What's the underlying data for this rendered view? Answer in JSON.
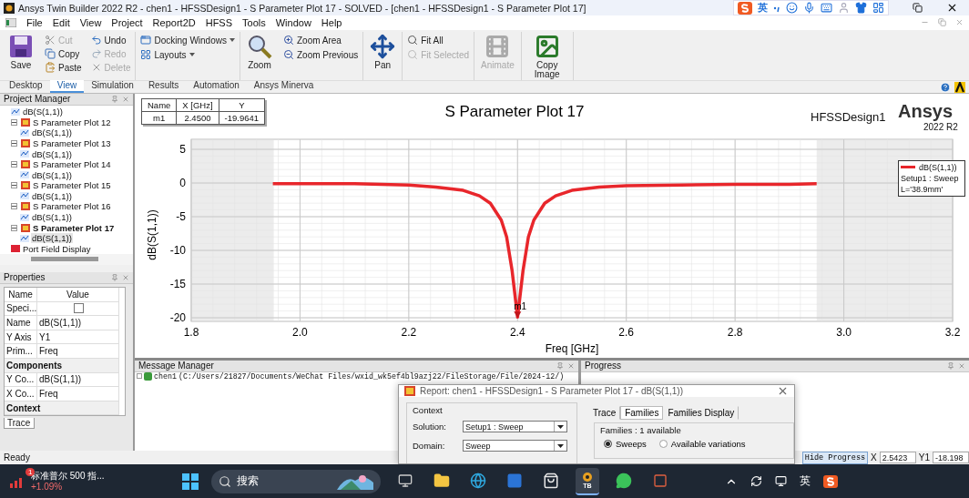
{
  "window": {
    "title": "Ansys Twin Builder 2022 R2 - chen1 - HFSSDesign1 - S Parameter Plot 17 - SOLVED - [chen1 - HFSSDesign1 - S Parameter Plot 17]"
  },
  "ime_toolbar": {
    "mode": "英"
  },
  "menu": [
    "File",
    "Edit",
    "View",
    "Project",
    "Report2D",
    "HFSS",
    "Tools",
    "Window",
    "Help"
  ],
  "ribbon": [
    {
      "kind": "large",
      "label": "Save",
      "disabled": false
    },
    {
      "kind": "stack",
      "items": [
        {
          "label": "Cut",
          "disabled": true
        },
        {
          "label": "Copy",
          "disabled": false
        },
        {
          "label": "Paste",
          "disabled": false
        }
      ]
    },
    {
      "kind": "stack",
      "items": [
        {
          "label": "Undo",
          "disabled": false
        },
        {
          "label": "Redo",
          "disabled": true
        },
        {
          "label": "Delete",
          "disabled": true
        }
      ],
      "divider": true
    },
    {
      "kind": "stack",
      "items": [
        {
          "label": "Docking Windows",
          "disabled": false,
          "dropdown": true
        },
        {
          "label": "Layouts",
          "disabled": false,
          "dropdown": true
        }
      ],
      "divider": true
    },
    {
      "kind": "large",
      "label": "Zoom",
      "disabled": false
    },
    {
      "kind": "stack",
      "items": [
        {
          "label": "Zoom Area",
          "disabled": false
        },
        {
          "label": "Zoom Previous",
          "disabled": false
        }
      ],
      "divider": true
    },
    {
      "kind": "large",
      "label": "Pan",
      "disabled": false,
      "divider": true
    },
    {
      "kind": "stack",
      "items": [
        {
          "label": "Fit All",
          "disabled": false
        },
        {
          "label": "Fit Selected",
          "disabled": true
        }
      ],
      "divider": true
    },
    {
      "kind": "large",
      "label": "Animate",
      "disabled": true,
      "divider": true
    },
    {
      "kind": "large",
      "label": "Copy Image",
      "disabled": false,
      "divider": true
    }
  ],
  "ribbon_tabs": [
    {
      "label": "Desktop",
      "selected": false
    },
    {
      "label": "View",
      "selected": true
    },
    {
      "label": "Simulation",
      "selected": false
    },
    {
      "label": "Results",
      "selected": false
    },
    {
      "label": "Automation",
      "selected": false
    },
    {
      "label": "Ansys Minerva",
      "selected": false
    }
  ],
  "project_manager": {
    "title": "Project Manager",
    "items": [
      {
        "kind": "trace",
        "label": "dB(S(1,1))",
        "selected": false
      },
      {
        "kind": "plot",
        "label": "S Parameter Plot 12",
        "selected": false,
        "expanded": true,
        "children": [
          {
            "kind": "trace",
            "label": "dB(S(1,1))",
            "selected": false
          }
        ]
      },
      {
        "kind": "plot",
        "label": "S Parameter Plot 13",
        "selected": false,
        "expanded": true,
        "children": [
          {
            "kind": "trace",
            "label": "dB(S(1,1))",
            "selected": false
          }
        ]
      },
      {
        "kind": "plot",
        "label": "S Parameter Plot 14",
        "selected": false,
        "expanded": true,
        "children": [
          {
            "kind": "trace",
            "label": "dB(S(1,1))",
            "selected": false
          }
        ]
      },
      {
        "kind": "plot",
        "label": "S Parameter Plot 15",
        "selected": false,
        "expanded": true,
        "children": [
          {
            "kind": "trace",
            "label": "dB(S(1,1))",
            "selected": false
          }
        ]
      },
      {
        "kind": "plot",
        "label": "S Parameter Plot 16",
        "selected": false,
        "expanded": true,
        "children": [
          {
            "kind": "trace",
            "label": "dB(S(1,1))",
            "selected": false
          }
        ]
      },
      {
        "kind": "plot",
        "label": "S Parameter Plot 17",
        "selected": true,
        "expanded": true,
        "children": [
          {
            "kind": "trace",
            "label": "dB(S(1,1))",
            "selected": true
          }
        ]
      },
      {
        "kind": "field",
        "label": "Port Field Display",
        "selected": false
      }
    ]
  },
  "properties": {
    "title": "Properties",
    "columns": [
      "Name",
      "Value"
    ],
    "rows": [
      {
        "kind": "checkbox",
        "name": "Speci...",
        "checked": false
      },
      {
        "kind": "row",
        "name": "Name",
        "value": "dB(S(1,1))"
      },
      {
        "kind": "row",
        "name": "Y Axis",
        "value": "Y1"
      },
      {
        "kind": "row",
        "name": "Prim...",
        "value": "Freq"
      },
      {
        "kind": "section",
        "name": "Components"
      },
      {
        "kind": "row",
        "name": "Y Co...",
        "value": "dB(S(1,1))"
      },
      {
        "kind": "row",
        "name": "X Co...",
        "value": "Freq"
      },
      {
        "kind": "section",
        "name": "Context"
      }
    ],
    "tab": "Trace"
  },
  "plot": {
    "design": "HFSSDesign1",
    "brand": "Ansys",
    "version": "2022 R2",
    "markers": {
      "columns": [
        "Name",
        "X [GHz]",
        "Y"
      ],
      "rows": [
        [
          "m1",
          "2.4500",
          "-19.9641"
        ]
      ]
    },
    "legend": {
      "lines": [
        "Setup1 : Sweep",
        "L='38.9mm'"
      ]
    },
    "chart_data": {
      "type": "line",
      "title": "S Parameter Plot 17",
      "xlabel": "Freq [GHz]",
      "ylabel": "dB(S(1,1))",
      "x": [
        1.95,
        2.0,
        2.05,
        2.1,
        2.15,
        2.2,
        2.25,
        2.3,
        2.33,
        2.35,
        2.37,
        2.38,
        2.39,
        2.4,
        2.41,
        2.42,
        2.43,
        2.45,
        2.47,
        2.5,
        2.55,
        2.6,
        2.7,
        2.8,
        2.9,
        2.95
      ],
      "series": [
        {
          "name": "dB(S(1,1))",
          "color": "#e8262b",
          "values": [
            -0.1,
            -0.1,
            -0.1,
            -0.1,
            -0.2,
            -0.3,
            -0.6,
            -1.1,
            -1.9,
            -3.0,
            -5.5,
            -8.0,
            -13.0,
            -19.9,
            -13.0,
            -8.0,
            -5.5,
            -3.0,
            -1.9,
            -1.1,
            -0.6,
            -0.4,
            -0.3,
            -0.2,
            -0.2,
            -0.1
          ]
        }
      ],
      "grid": true,
      "xlim": [
        1.8,
        3.2
      ],
      "ylim": [
        -20,
        5
      ],
      "xticks": [
        {
          "value": 1.8,
          "label": "1.8"
        },
        {
          "value": 2.0,
          "label": "2.0"
        },
        {
          "value": 2.2,
          "label": "2.2"
        },
        {
          "value": 2.4,
          "label": "2.4"
        },
        {
          "value": 2.6,
          "label": "2.6"
        },
        {
          "value": 2.8,
          "label": "2.8"
        },
        {
          "value": 3.0,
          "label": "3.0"
        },
        {
          "value": 3.2,
          "label": "3.2"
        }
      ],
      "yticks": [
        -20,
        -15,
        -10,
        -5,
        0,
        5
      ],
      "annotations": [
        {
          "x": 2.4,
          "y": -19.9,
          "text": "m1"
        }
      ]
    }
  },
  "message_manager": {
    "title": "Message Manager",
    "lines": [
      {
        "project": "chen1",
        "path": "(C:/Users/21827/Documents/WeChat Files/wxid_wk5ef4bl9azj22/FileStorage/File/2024-12/)"
      }
    ]
  },
  "progress": {
    "title": "Progress"
  },
  "dialog": {
    "title": "Report: chen1 - HFSSDesign1 - S Parameter Plot 17 - dB(S(1,1))",
    "context_title": "Context",
    "fields": [
      {
        "label": "Solution:",
        "value": "Setup1 : Sweep"
      },
      {
        "label": "Domain:",
        "value": "Sweep"
      }
    ],
    "tabs": [
      {
        "label": "Trace",
        "selected": false
      },
      {
        "label": "Families",
        "selected": true
      },
      {
        "label": "Families Display",
        "selected": false
      }
    ],
    "families_title": "Families : 1 available",
    "options": [
      {
        "label": "Sweeps",
        "selected": true
      },
      {
        "label": "Available variations",
        "selected": false
      }
    ]
  },
  "status_bar": {
    "text": "Ready",
    "button": "Hide Progress",
    "x_label": "X",
    "x_value": "2.5423",
    "y_label": "Y1",
    "y_value": "-18.198"
  },
  "taskbar": {
    "widget": {
      "badge": "1",
      "title": "标准普尔 500 指...",
      "change": "+1.09%"
    },
    "search": "搜索",
    "apps": [
      {
        "selected": false
      },
      {
        "selected": false
      },
      {
        "selected": false
      },
      {
        "selected": false
      },
      {
        "selected": false
      },
      {
        "label": "TB",
        "selected": true
      },
      {
        "selected": false
      },
      {
        "selected": false
      }
    ],
    "input_mode": "英"
  }
}
